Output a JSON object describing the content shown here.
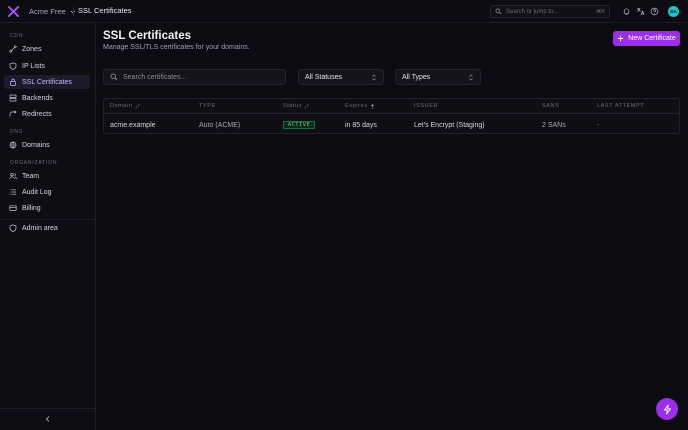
{
  "topbar": {
    "org_name": "Acme Free",
    "breadcrumb": "SSL Certificates",
    "search_placeholder": "Search or jump to...",
    "search_shortcut": "⌘K",
    "avatar_initials": "DA"
  },
  "sidebar": {
    "sections": [
      {
        "title": "CDN",
        "items": [
          "Zones",
          "IP Lists",
          "SSL Certificates",
          "Backends",
          "Redirects"
        ]
      },
      {
        "title": "DNS",
        "items": [
          "Domains"
        ]
      },
      {
        "title": "ORGANIZATION",
        "items": [
          "Team",
          "Audit Log",
          "Billing"
        ]
      }
    ],
    "admin_item": "Admin area",
    "active_item": "SSL Certificates"
  },
  "page": {
    "title": "SSL Certificates",
    "subtitle": "Manage SSL/TLS certificates for your domains.",
    "new_button": "New Certificate"
  },
  "filters": {
    "search_placeholder": "Search certificates...",
    "status_select": "All Statuses",
    "type_select": "All Types"
  },
  "table": {
    "columns": [
      "Domain",
      "TYPE",
      "Status",
      "Expires",
      "ISSUER",
      "SANS",
      "LAST ATTEMPT"
    ],
    "rows": [
      {
        "domain": "acme.example",
        "type": "Auto (ACME)",
        "status": "ACTIVE",
        "expires": "in 85 days",
        "issuer": "Let's Encrypt (Staging)",
        "sans": "2 SANs",
        "last_attempt": "-"
      }
    ]
  },
  "colors": {
    "accent": "#9b2fe8",
    "active_nav_text": "#c9b3ff",
    "status_active": "#49d68b",
    "avatar": "#1fc6c4"
  }
}
